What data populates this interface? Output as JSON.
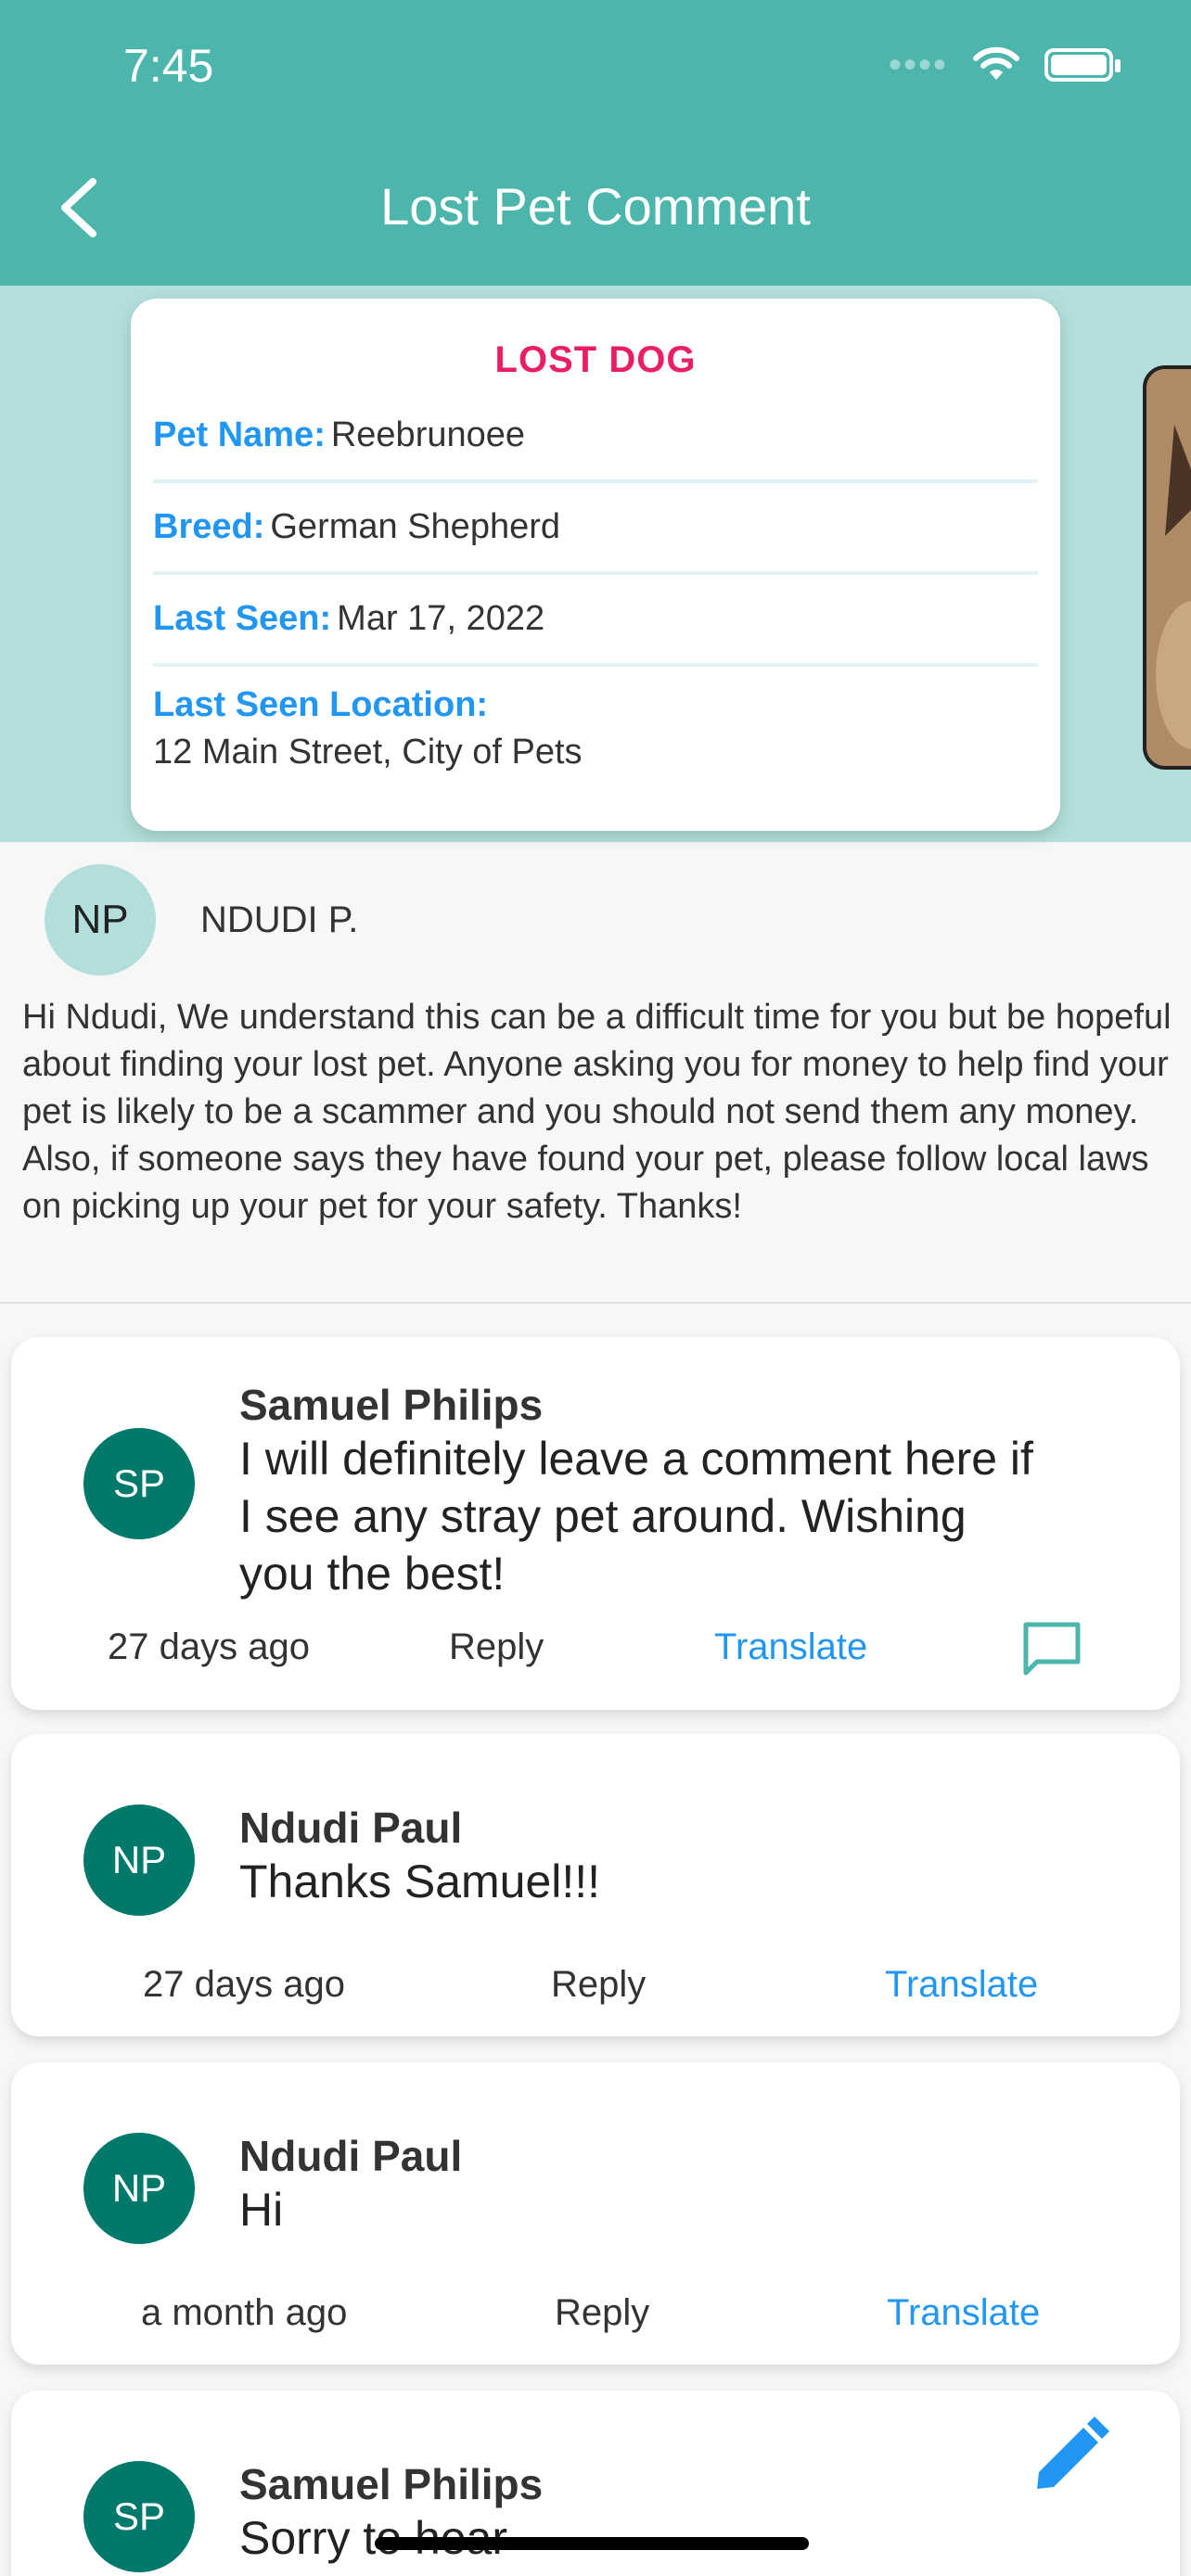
{
  "status_bar": {
    "time": "7:45"
  },
  "header": {
    "title": "Lost Pet Comment"
  },
  "pet_card": {
    "heading": "LOST DOG",
    "fields": [
      {
        "label": "Pet Name:",
        "value": "Reebrunoee"
      },
      {
        "label": "Breed:",
        "value": "German Shepherd"
      },
      {
        "label": "Last Seen:",
        "value": "Mar 17, 2022"
      },
      {
        "label": "Last Seen Location:",
        "value": "12 Main Street, City of Pets"
      }
    ]
  },
  "info": {
    "initials": "NP",
    "name": "NDUDI P.",
    "message": "Hi Ndudi, We understand this can be a difficult time for you but be hopeful about finding your lost pet. Anyone asking you for money to help find your pet is likely to be a scammer and you should not send them any money. Also, if someone says they have found your pet, please follow local laws on picking up your pet for your safety. Thanks!"
  },
  "comments": [
    {
      "initials": "SP",
      "name": "Samuel Philips",
      "text": "I will definitely leave a comment here if I see any stray pet around. Wishing you the best!",
      "time": "27 days ago",
      "reply": "Reply",
      "translate": "Translate"
    },
    {
      "initials": "NP",
      "name": "Ndudi Paul",
      "text": "Thanks Samuel!!!",
      "time": "27 days ago",
      "reply": "Reply",
      "translate": "Translate"
    },
    {
      "initials": "NP",
      "name": "Ndudi Paul",
      "text": "Hi",
      "time": "a month ago",
      "reply": "Reply",
      "translate": "Translate"
    },
    {
      "initials": "SP",
      "name": "Samuel Philips",
      "text": "Sorry to hear"
    }
  ],
  "colors": {
    "header": "#4db6ac",
    "accent": "#2196f3",
    "lost": "#e91e63",
    "avatar": "#00796b"
  },
  "icons": [
    "back-icon",
    "wifi-icon",
    "battery-icon",
    "chat-icon",
    "edit-icon"
  ]
}
